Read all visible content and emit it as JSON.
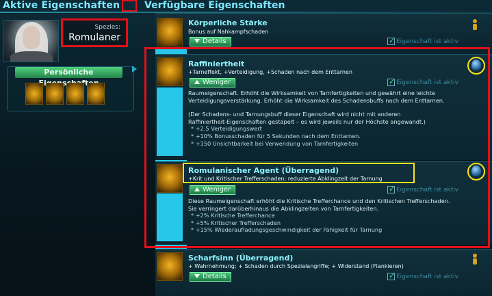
{
  "headers": {
    "left_title": "Aktive Eigenschaften",
    "right_title": "Verfügbare Eigenschaften"
  },
  "character": {
    "species_label": "Spezies:",
    "species_value": "Romulaner"
  },
  "personal": {
    "tab_label": "Persönliche Eigenschaften",
    "icons": [
      "arm-icon",
      "face-icon",
      "head-icon",
      "head-icon"
    ]
  },
  "traits": [
    {
      "title": "Körperliche Stärke",
      "subtitle": "Bonus auf Nahkampfschaden",
      "button": "Details",
      "active_label": "Eigenschaft ist aktiv"
    },
    {
      "title": "Raffiniertheit",
      "subtitle": "+Tarneffekt, +Verteidigung, +Schaden nach dem Enttarnen",
      "button": "Weniger",
      "active_label": "Eigenschaft ist aktiv",
      "desc": [
        "Raumeigenschaft. Erhöht die Wirksamkeit von Tarnfertigkeiten und gewährt eine leichte",
        "Verteidigungsverstärkung. Erhöht die Wirksamkeit des Schadensbuffs nach dem Enttarnen.",
        "",
        "(Der Schadens- und Tarnungsbuff dieser Eigenschaft wird nicht mit anderen",
        "Raffiniertheit-Eigenschaften gestapelt – es wird jeweils nur der Höchste angewandt.)",
        "* +2.5 Verteidigungswert",
        "* +10% Bonusschaden für 5 Sekunden nach dem Enttarnen.",
        "* +150 Unsichtbarkeit bei Verwendung von Tarnfertigkeiten"
      ]
    },
    {
      "title": "Romulanischer Agent (Überragend)",
      "subtitle": "+Krit und Kritischer Trefferschaden; reduzierte Abklingzeit der Tarnung",
      "button": "Weniger",
      "active_label": "Eigenschaft ist aktiv",
      "desc": [
        "Diese Raumeigenschaft erhöht die Kritische Trefferchance und den Kritischen Trefferschaden.",
        "Sie verringert darüberhinaus die Abklingzeiten von Tarnfertigkeiten.",
        "* +2% Kritische Trefferchance",
        "* +5% Kritischer Trefferschaden",
        "* +15% Wiederaufladungsgeschwindigkeit der Fähigkeit für Tarnung"
      ]
    },
    {
      "title": "Scharfsinn (Überragend)",
      "subtitle": "+ Wahrnehmung; + Schaden durch Spezialangriffe; + Widerstand (Flankieren)",
      "button": "Details",
      "active_label": "Eigenschaft ist aktiv"
    }
  ],
  "colors": {
    "accent": "#7fe8ff",
    "rail": "#27c7ea",
    "button": "#2fa460",
    "annotation_red": "#e3101a",
    "annotation_yellow": "#ffe21a"
  }
}
